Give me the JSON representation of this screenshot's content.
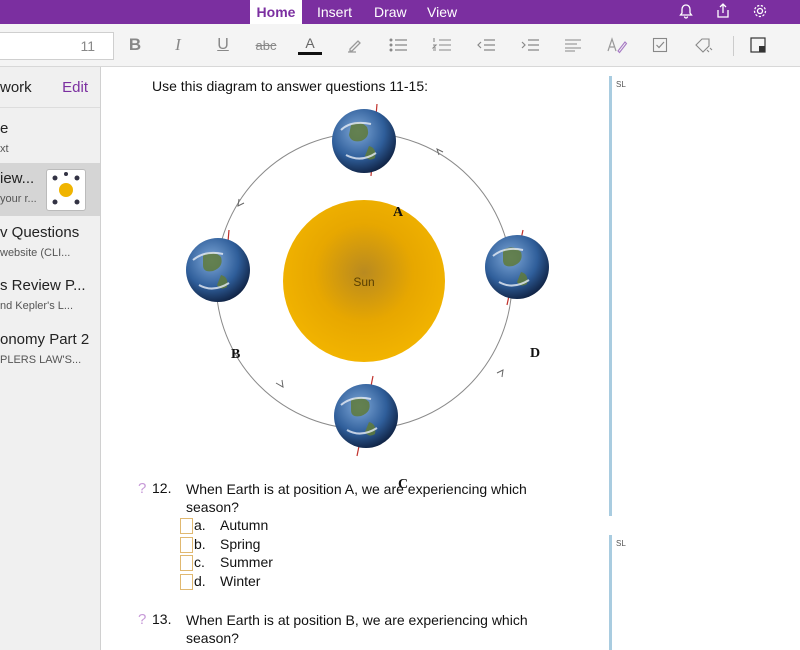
{
  "tabs": [
    {
      "label": "Home",
      "active": true
    },
    {
      "label": "Insert",
      "active": false
    },
    {
      "label": "Draw",
      "active": false
    },
    {
      "label": "View",
      "active": false
    }
  ],
  "colors": {
    "accent": "#7b2fa0",
    "sun": "#f0b400",
    "orbit": "#888888"
  },
  "ribbon": {
    "font_size": "11",
    "icons": [
      "bold-icon",
      "italic-icon",
      "underline-icon",
      "strikethrough-icon",
      "font-color-icon",
      "highlight-icon",
      "bullet-list-icon",
      "numbered-list-icon",
      "outdent-icon",
      "indent-icon",
      "align-icon",
      "styles-icon",
      "todo-tag-icon",
      "tag-icon",
      "more-icon"
    ]
  },
  "sidebar": {
    "title": "work",
    "edit_label": "Edit",
    "pages": [
      {
        "title": "e",
        "subtitle": "xt"
      },
      {
        "title": "iew...",
        "subtitle": "your r...",
        "selected": true
      },
      {
        "title": "v Questions",
        "subtitle": "website (CLI..."
      },
      {
        "title": "s Review P...",
        "subtitle": "nd Kepler's L..."
      },
      {
        "title": "onomy Part 2",
        "subtitle": "PLERS LAW'S..."
      }
    ]
  },
  "content": {
    "instructions": "Use this diagram to answer questions 11-15:",
    "diagram": {
      "sun_label": "Sun",
      "positions": [
        "A",
        "B",
        "C",
        "D"
      ]
    },
    "questions": [
      {
        "number": "12.",
        "text": "When Earth is at position A, we are experiencing which season?",
        "options": [
          {
            "letter": "a.",
            "text": "Autumn"
          },
          {
            "letter": "b.",
            "text": "Spring"
          },
          {
            "letter": "c.",
            "text": "Summer"
          },
          {
            "letter": "d.",
            "text": "Winter"
          }
        ]
      },
      {
        "number": "13.",
        "text": "When Earth is at position B, we are experiencing which season?",
        "options": []
      }
    ],
    "side_tags": [
      "SL",
      "SL"
    ]
  }
}
